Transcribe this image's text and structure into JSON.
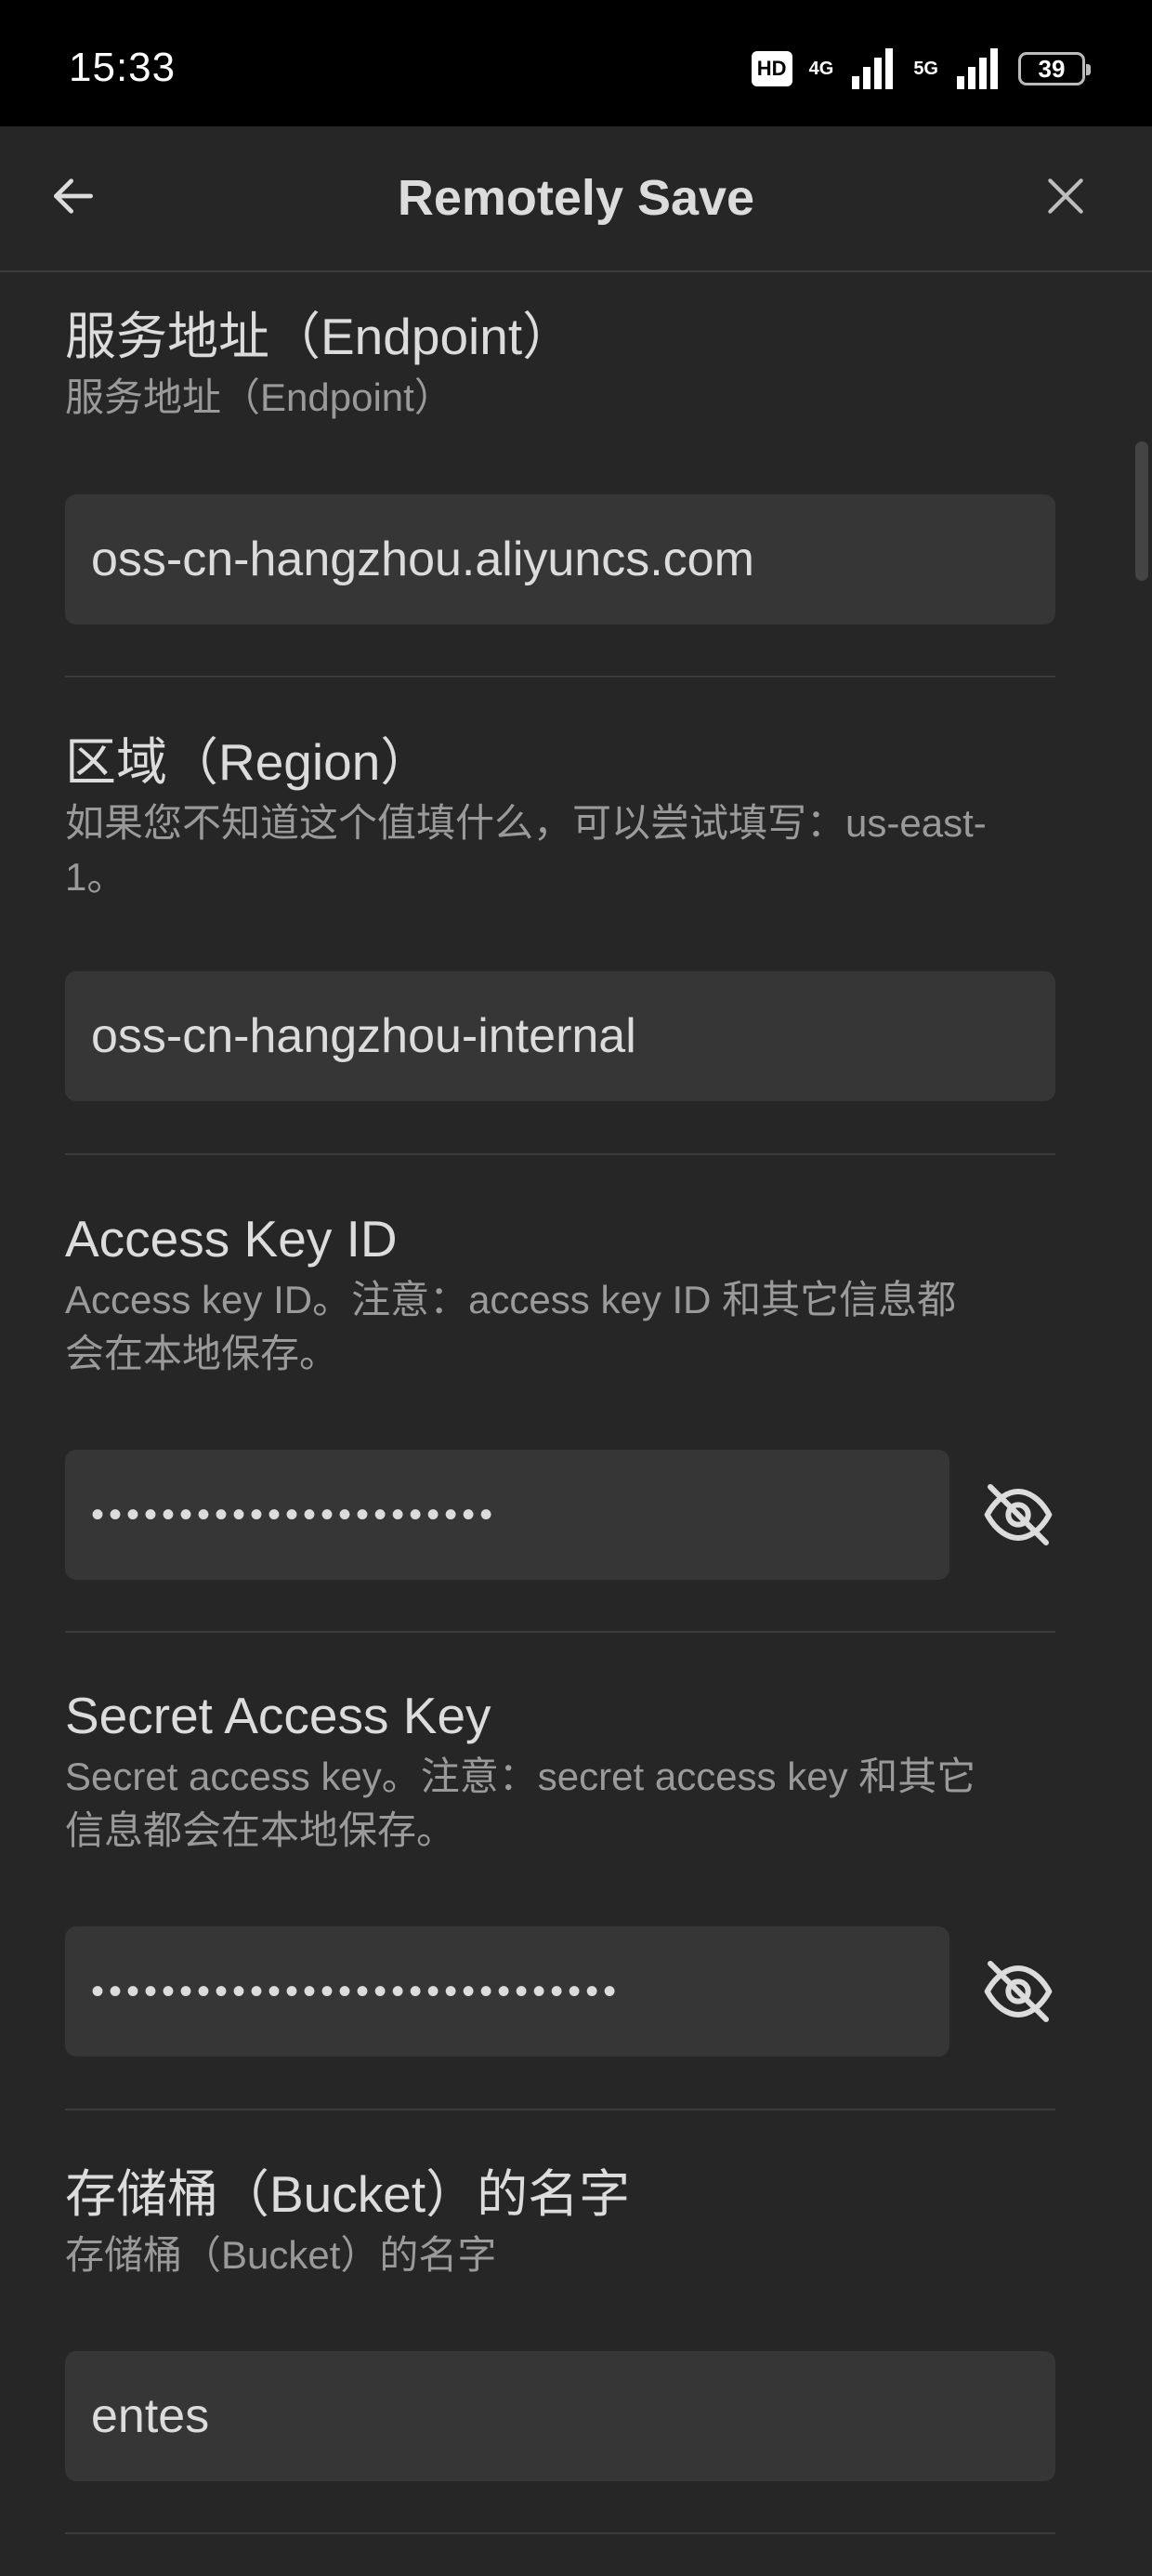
{
  "status_bar": {
    "time": "15:33",
    "hd_label": "HD",
    "net_4g": "4G",
    "net_5g": "5G",
    "battery": "39"
  },
  "header": {
    "title": "Remotely Save",
    "back_icon": "arrow-left-icon",
    "close_icon": "close-icon"
  },
  "settings": {
    "endpoint": {
      "name": "服务地址（Endpoint）",
      "desc": "服务地址（Endpoint）",
      "value": "oss-cn-hangzhou.aliyuncs.com"
    },
    "region": {
      "name": "区域（Region）",
      "desc": "如果您不知道这个值填什么，可以尝试填写：us-east-1。",
      "value": "oss-cn-hangzhou-internal"
    },
    "access_key": {
      "name": "Access Key ID",
      "desc": "Access key ID。注意：access key ID 和其它信息都会在本地保存。",
      "masked_value": "•••••••••••••••••••••••",
      "toggle_icon": "eye-off-icon"
    },
    "secret_key": {
      "name": "Secret Access Key",
      "desc": "Secret access key。注意：secret access key 和其它信息都会在本地保存。",
      "masked_value": "••••••••••••••••••••••••••••••",
      "toggle_icon": "eye-off-icon"
    },
    "bucket": {
      "name": "存储桶（Bucket）的名字",
      "desc": "存储桶（Bucket）的名字",
      "value": "entes"
    }
  },
  "colors": {
    "background": "#262626",
    "input_bg": "#363636",
    "text": "#dcdcdc",
    "muted_text": "#9a9a9a"
  }
}
